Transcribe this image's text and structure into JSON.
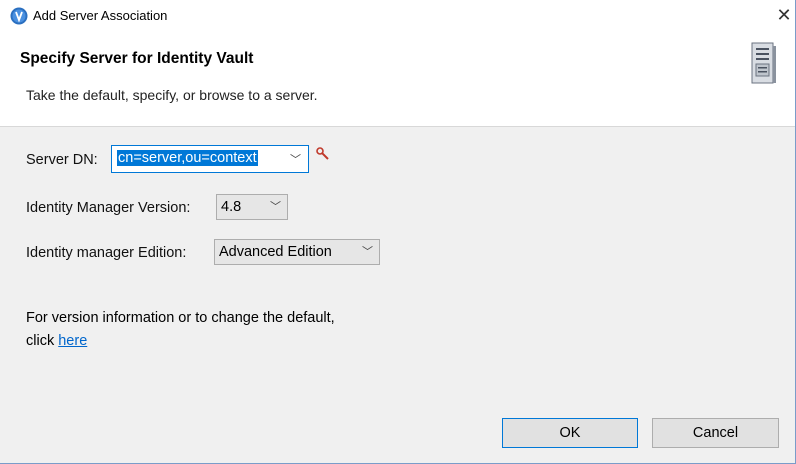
{
  "window": {
    "title": "Add Server Association",
    "close_glyph": "✕"
  },
  "banner": {
    "title": "Specify Server for Identity Vault",
    "description": "Take the default, specify, or browse to a server."
  },
  "form": {
    "server_dn": {
      "label": "Server DN:",
      "value": "cn=server,ou=context"
    },
    "im_version": {
      "label": "Identity Manager Version:",
      "value": "4.8"
    },
    "im_edition": {
      "label": "Identity manager Edition:",
      "value": "Advanced Edition"
    }
  },
  "info": {
    "text": "For version information or to change the default, click",
    "link": "here"
  },
  "buttons": {
    "ok": "OK",
    "cancel": "Cancel"
  },
  "icons": {
    "app": "novell-n-icon",
    "server": "server-icon",
    "search": "search-icon",
    "dropdown": "chevron-down-icon"
  },
  "colors": {
    "accent": "#0078d7",
    "link": "#0066cc"
  }
}
